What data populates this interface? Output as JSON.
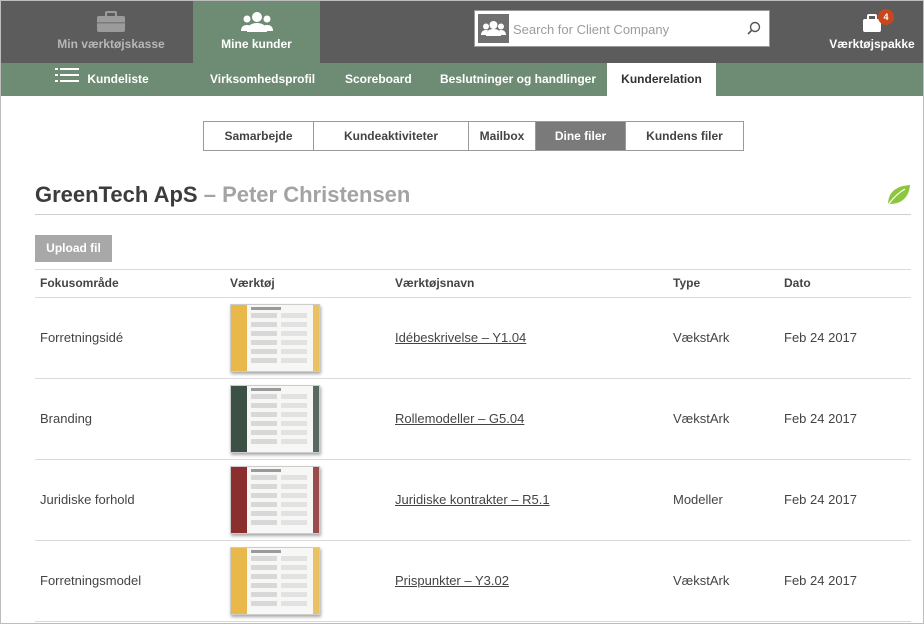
{
  "topbar": {
    "toolbox_label": "Min værktøjskasse",
    "clients_label": "Mine kunder",
    "package_label": "Værktøjspakke",
    "package_badge": "4",
    "search": {
      "placeholder": "Search for Client Company",
      "value": ""
    }
  },
  "subnav": {
    "client_list": "Kundeliste",
    "items": [
      "Virksomhedsprofil",
      "Scoreboard",
      "Beslutninger og handlinger",
      "Kunderelation"
    ],
    "active": "Kunderelation"
  },
  "tabs": {
    "items": [
      "Samarbejde",
      "Kundeaktiviteter",
      "Mailbox",
      "Dine filer",
      "Kundens filer"
    ],
    "active": "Dine filer"
  },
  "heading": {
    "company": "GreenTech ApS",
    "separator": " – ",
    "person": "Peter Christensen"
  },
  "upload_label": "Upload fil",
  "table": {
    "columns": [
      "Fokusområde",
      "Værktøj",
      "Værktøjsnavn",
      "Type",
      "Dato"
    ],
    "rows": [
      {
        "focus": "Forretningsidé",
        "tool_name": "Idébeskrivelse – Y1.04",
        "type": "VækstArk",
        "date": "Feb 24 2017",
        "thumb_color": "#e8b84a"
      },
      {
        "focus": "Branding",
        "tool_name": "Rollemodeller – G5.04",
        "type": "VækstArk",
        "date": "Feb 24 2017",
        "thumb_color": "#3d5046"
      },
      {
        "focus": "Juridiske forhold",
        "tool_name": "Juridiske kontrakter – R5.1",
        "type": "Modeller",
        "date": "Feb 24 2017",
        "thumb_color": "#8a2e2e"
      },
      {
        "focus": "Forretningsmodel",
        "tool_name": "Prispunkter – Y3.02",
        "type": "VækstArk",
        "date": "Feb 24 2017",
        "thumb_color": "#e8b84a"
      }
    ]
  },
  "colors": {
    "topbar": "#5c5c5c",
    "accent_green": "#6e8c74",
    "badge": "#c9471f",
    "leaf": "#8cc63f"
  },
  "icons": [
    "toolbox-icon",
    "clients-icon",
    "package-icon",
    "search-people-icon",
    "magnifier-icon",
    "hamburger-icon",
    "leaf-icon"
  ]
}
